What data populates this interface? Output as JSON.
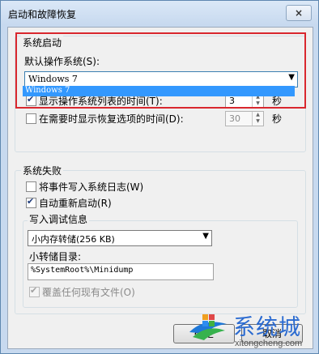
{
  "window": {
    "title": "启动和故障恢复",
    "close_label": "×"
  },
  "system_startup": {
    "group_label": "系统启动",
    "default_os_label": "默认操作系统(S):",
    "default_os_value": "Windows 7",
    "dropdown_option": "Windows 7",
    "show_os_list_label": "显示操作系统列表的时间(T):",
    "show_os_list_checked": true,
    "show_os_list_seconds": "3",
    "show_recovery_label": "在需要时显示恢复选项的时间(D):",
    "show_recovery_checked": false,
    "show_recovery_seconds": "30",
    "seconds_unit": "秒"
  },
  "system_failure": {
    "group_label": "系统失败",
    "write_event_label": "将事件写入系统日志(W)",
    "write_event_checked": false,
    "auto_restart_label": "自动重新启动(R)",
    "auto_restart_checked": true,
    "debug_info": {
      "group_label": "写入调试信息",
      "dump_type_value": "小内存转储(256 KB)",
      "dump_dir_label": "小转储目录:",
      "dump_dir_value": "%SystemRoot%\\Minidump",
      "overwrite_label": "覆盖任何现有文件(O)",
      "overwrite_checked": true
    }
  },
  "buttons": {
    "ok_label": "确定",
    "cancel_label": "取消"
  },
  "watermark": {
    "brand": "系统城",
    "url": "xitongcheng.com"
  },
  "colors": {
    "highlight": "#d9272e",
    "selection": "#3398fe"
  }
}
